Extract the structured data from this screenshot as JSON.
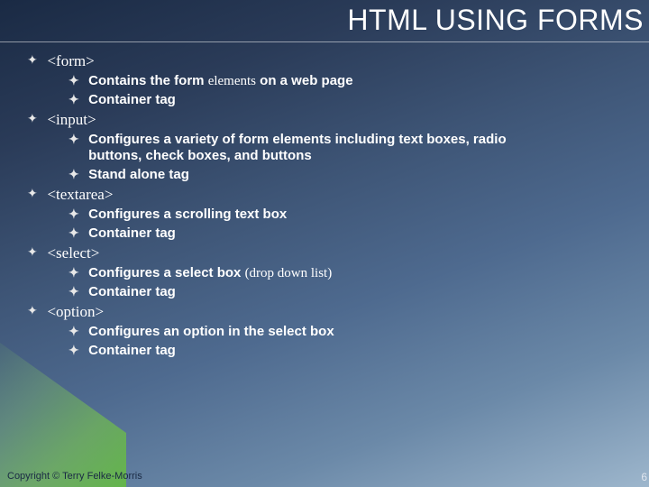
{
  "title": "HTML USING FORMS",
  "items": [
    {
      "label": "<form>",
      "subs": [
        {
          "pre": "Contains the form ",
          "serif": "elements",
          "post": " on a web page"
        },
        {
          "pre": "Container tag",
          "serif": "",
          "post": ""
        }
      ]
    },
    {
      "label": "<input>",
      "subs": [
        {
          "pre": "Configures a variety of form elements including text boxes, radio buttons, check boxes, and buttons",
          "serif": "",
          "post": ""
        },
        {
          "pre": "Stand alone tag",
          "serif": "",
          "post": ""
        }
      ]
    },
    {
      "label": "<textarea>",
      "subs": [
        {
          "pre": "Configures a scrolling text box",
          "serif": "",
          "post": ""
        },
        {
          "pre": "Container tag",
          "serif": "",
          "post": ""
        }
      ]
    },
    {
      "label": "<select>",
      "subs": [
        {
          "pre": "Configures  a select box ",
          "serif": "(drop down list)",
          "post": ""
        },
        {
          "pre": "Container tag",
          "serif": "",
          "post": ""
        }
      ]
    },
    {
      "label": "<option>",
      "subs": [
        {
          "pre": "Configures an option in the select box",
          "serif": "",
          "post": ""
        },
        {
          "pre": "Container tag",
          "serif": "",
          "post": ""
        }
      ]
    }
  ],
  "footer": "Copyright © Terry Felke-Morris",
  "pagenum": "6",
  "bullet_glyph": "✦"
}
